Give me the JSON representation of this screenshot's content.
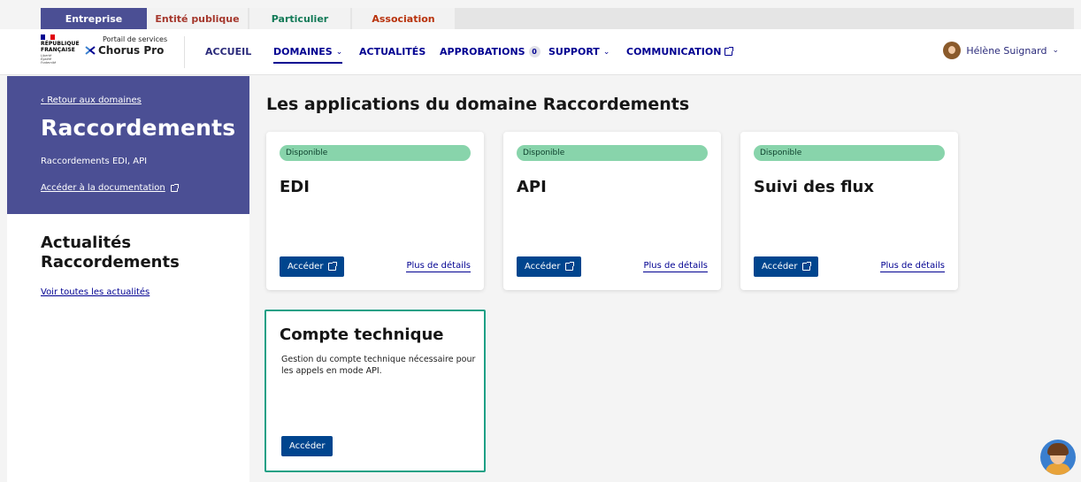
{
  "audience_tabs": [
    {
      "label": "Entreprise",
      "active": true
    },
    {
      "label": "Entité publique",
      "active": false
    },
    {
      "label": "Particulier",
      "active": false
    },
    {
      "label": "Association",
      "active": false
    }
  ],
  "header": {
    "rf_lines": [
      "RÉPUBLIQUE",
      "FRANÇAISE"
    ],
    "rf_motto": [
      "Liberté",
      "Égalité",
      "Fraternité"
    ],
    "portal_subtitle": "Portail de services",
    "portal_title": "Chorus Pro",
    "nav": {
      "accueil": "ACCUEIL",
      "domaines": "DOMAINES",
      "actualites": "ACTUALITÉS",
      "approbations": "APPROBATIONS",
      "approbations_count": "0",
      "support": "SUPPORT",
      "communication": "COMMUNICATION"
    },
    "user_name": "Hélène Suignard"
  },
  "sidebar": {
    "back_link": "Retour aux domaines",
    "title": "Raccordements",
    "subtitle": "Raccordements EDI, API",
    "doc_link": "Accéder à la documentation",
    "news_title_line1": "Actualités",
    "news_title_line2": "Raccordements",
    "news_link": "Voir toutes les actualités"
  },
  "main": {
    "title": "Les applications du domaine Raccordements",
    "cards": [
      {
        "status": "Disponible",
        "title": "EDI",
        "button": "Accéder",
        "details": "Plus de détails"
      },
      {
        "status": "Disponible",
        "title": "API",
        "button": "Accéder",
        "details": "Plus de détails"
      },
      {
        "status": "Disponible",
        "title": "Suivi des flux",
        "button": "Accéder",
        "details": "Plus de détails"
      }
    ],
    "tech_card": {
      "title": "Compte technique",
      "description": "Gestion du compte technique nécessaire pour les appels en mode API.",
      "button": "Accéder"
    }
  },
  "colors": {
    "brand_blue": "#000091",
    "sidebar_blue": "#4b4f94",
    "available_green": "#88d4ab",
    "button_blue": "#00458e",
    "highlight_border": "#1da085"
  }
}
